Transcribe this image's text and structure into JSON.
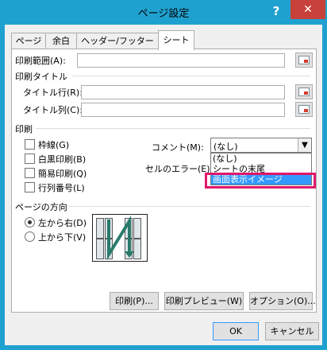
{
  "window": {
    "title": "ページ設定",
    "help_label": "?",
    "close_label": "✕"
  },
  "tabs": [
    {
      "label": "ページ",
      "active": false
    },
    {
      "label": "余白",
      "active": false
    },
    {
      "label": "ヘッダー/フッター",
      "active": false
    },
    {
      "label": "シート",
      "active": true
    }
  ],
  "print_area": {
    "label": "印刷範囲(A):",
    "value": ""
  },
  "print_titles": {
    "heading": "印刷タイトル",
    "rows_label": "タイトル行(R):",
    "cols_label": "タイトル列(C):"
  },
  "print": {
    "heading": "印刷",
    "gridlines": {
      "label": "枠線(G)",
      "checked": false
    },
    "black_white": {
      "label": "白黒印刷(B)",
      "checked": false
    },
    "draft": {
      "label": "簡易印刷(Q)",
      "checked": false
    },
    "row_col_headings": {
      "label": "行列番号(L)",
      "checked": false
    },
    "comments": {
      "label": "コメント(M):",
      "value": "(なし)"
    },
    "errors": {
      "label": "セルのエラー(E):"
    },
    "comment_options": [
      "(なし)",
      "シートの末尾",
      "画面表示イメージ"
    ]
  },
  "page_order": {
    "heading": "ページの方向",
    "down_then_over": {
      "label": "左から右(D)",
      "selected": true
    },
    "over_then_down": {
      "label": "上から下(V)",
      "selected": false
    }
  },
  "buttons": {
    "print": "印刷(P)...",
    "preview": "印刷プレビュー(W)",
    "options": "オプション(O)...",
    "ok": "OK",
    "cancel": "キャンセル"
  },
  "colors": {
    "titlebar": "#1fa1cf",
    "highlight": "#e0176b",
    "selection": "#3399ff"
  }
}
